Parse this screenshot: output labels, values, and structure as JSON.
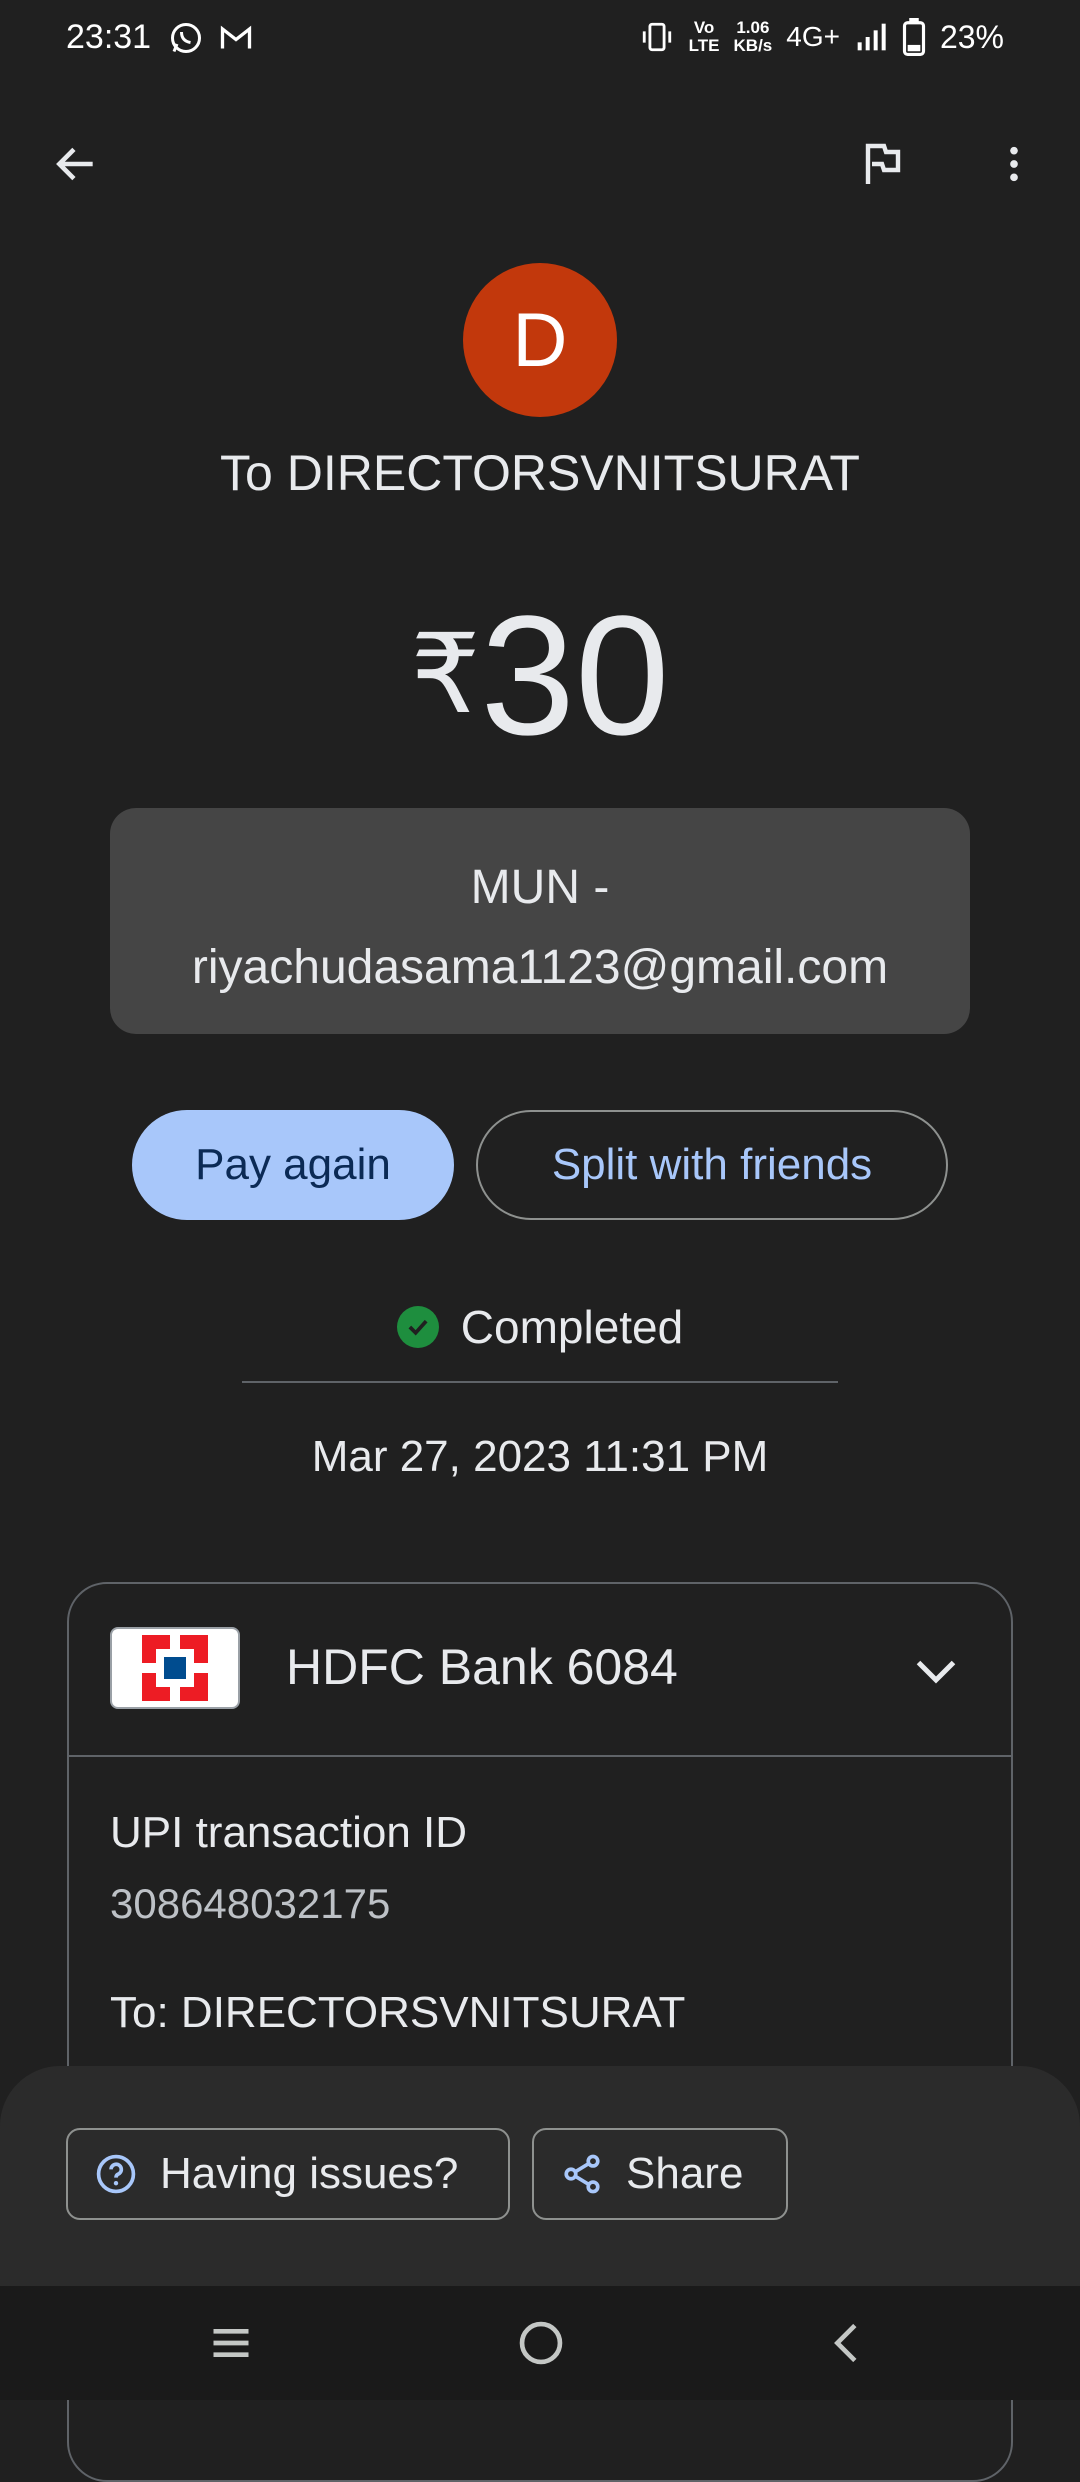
{
  "status_bar": {
    "time": "23:31",
    "network_speed_top": "1.06",
    "network_speed_bottom": "KB/s",
    "volte_top": "Vo",
    "volte_bottom": "LTE",
    "network_type": "4G+",
    "battery": "23%"
  },
  "avatar": {
    "initial": "D",
    "color": "#c2380c"
  },
  "recipient": "To DIRECTORSVNITSURAT",
  "amount": {
    "currency": "₹",
    "value": "30"
  },
  "note": "MUN - riyachudasama1123@gmail.com",
  "actions": {
    "pay_again": "Pay again",
    "split": "Split with friends"
  },
  "status": {
    "label": "Completed",
    "color": "#1e8e3e"
  },
  "datetime": "Mar 27, 2023 11:31 PM",
  "details": {
    "bank": "HDFC Bank 6084",
    "txn_label": "UPI transaction ID",
    "txn_id": "308648032175",
    "to_label": "To: DIRECTORSVNITSURAT"
  },
  "bottom": {
    "issues": "Having issues?",
    "share": "Share"
  },
  "accent": "#a8c7fa"
}
